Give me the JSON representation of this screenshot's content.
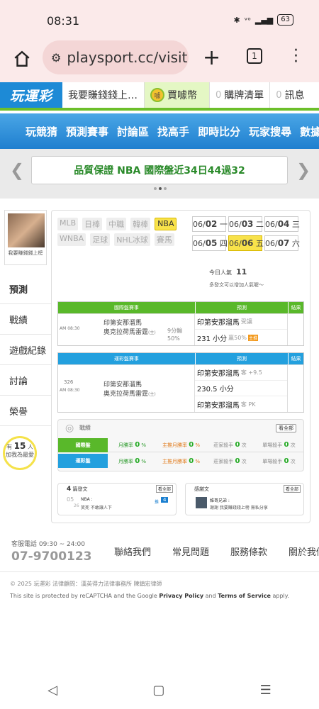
{
  "status": {
    "time": "08:31",
    "battery": "63"
  },
  "browser": {
    "url": "playsport.cc/visit",
    "tab_count": "1"
  },
  "topnav": {
    "logo": "玩運彩",
    "earn": "我要賺錢錢上…",
    "buy": "買噱幣",
    "coin_text": "噱",
    "cart_count": "0",
    "cart": "購牌清單",
    "msg_count": "0",
    "msg": "訊息"
  },
  "bluenav": [
    "玩競猜",
    "預測賽事",
    "討論區",
    "找高手",
    "即時比分",
    "玩家搜尋",
    "數據"
  ],
  "banner": {
    "text": "品質保證 NBA 國際盤近34日44過32"
  },
  "profile": {
    "name": "我要賺錢錢上榜"
  },
  "sidebar": [
    "預測",
    "戰績",
    "遊戲紀錄",
    "討論",
    "榮譽"
  ],
  "likes": {
    "pre": "有",
    "count": "15",
    "post": "人",
    "line2": "加我為最愛"
  },
  "sports": [
    {
      "label": "MLB",
      "active": false
    },
    {
      "label": "日棒",
      "active": false
    },
    {
      "label": "中職",
      "active": false
    },
    {
      "label": "韓棒",
      "active": false
    },
    {
      "label": "NBA",
      "active": true
    },
    {
      "label": "WNBA",
      "active": false
    },
    {
      "label": "足球",
      "active": false
    },
    {
      "label": "NHL冰球",
      "active": false
    },
    {
      "label": "賽馬",
      "active": false
    }
  ],
  "dates": [
    {
      "m": "06/",
      "d": "02",
      "w": "一",
      "active": false
    },
    {
      "m": "06/",
      "d": "03",
      "w": "二",
      "active": false
    },
    {
      "m": "06/",
      "d": "04",
      "w": "三",
      "active": false
    },
    {
      "m": "06/",
      "d": "05",
      "w": "四",
      "active": false
    },
    {
      "m": "06/",
      "d": "06",
      "w": "五",
      "active": true
    },
    {
      "m": "06/",
      "d": "07",
      "w": "六",
      "active": false
    }
  ],
  "popularity": {
    "label": "今日人氣",
    "value": "11",
    "hint": "多發文可以增加人氣喔～"
  },
  "intl_table": {
    "headers": [
      "國際盤賽事",
      "預測",
      "結果"
    ],
    "time": "AM 08:30",
    "team1": "印第安那溜馬",
    "team2": "奧克拉荷馬雷霆",
    "team2_suffix": "(主)",
    "margin": "9分輸",
    "pct": "50%",
    "pick1": "印第安那溜馬",
    "pick1_note": "受讓",
    "pick2": "231 小分",
    "pick2_note": "贏50%",
    "tag": "主推"
  },
  "lottery_table": {
    "headers": [
      "運彩盤賽事",
      "預測",
      "結果"
    ],
    "code": "326",
    "time": "AM 08:30",
    "team1": "印第安那溜馬",
    "team2": "奧克拉荷馬雷霆",
    "team2_suffix": "(主)",
    "pick1": "印第安那溜馬",
    "pick1_note": "客 +9.5",
    "pick2": "230.5 小分",
    "pick3": "印第安那溜馬",
    "pick3_note": "客 PK"
  },
  "record": {
    "title": "戰績",
    "all": "看全部",
    "rows": [
      {
        "label": "國際盤",
        "c1": "月勝率",
        "v1": "0",
        "u1": "%",
        "c2": "主推月勝率",
        "v2": "0",
        "u2": "%",
        "c3": "莊家殺手",
        "v3": "0",
        "u3": "次",
        "c4": "單場殺手",
        "v4": "0",
        "u4": "次",
        "color": "#59b82a"
      },
      {
        "label": "運彩盤",
        "c1": "月勝率",
        "v1": "0",
        "u1": "%",
        "c2": "主推月勝率",
        "v2": "0",
        "u2": "%",
        "c3": "莊家殺手",
        "v3": "0",
        "u3": "次",
        "c4": "單場殺手",
        "v4": "0",
        "u4": "次",
        "color": "#23a0de"
      }
    ]
  },
  "posts": {
    "count": "4",
    "label": "篇發文",
    "all": "看全部",
    "date_m": "05",
    "date_d": "26",
    "title": "NBA :",
    "sub": "笑死 不敢讓人下",
    "badge_label": "推",
    "badge": "4"
  },
  "thanks": {
    "label": "感謝文",
    "all": "看全部",
    "title": "維哥兄弟 :",
    "sub": "謝謝 我要賺錢錢上榜 無私分享"
  },
  "footer": {
    "tel_label": "客服電話 09:30 ~ 24:00",
    "tel": "07-9700123",
    "links": [
      "聯絡我們",
      "常見問題",
      "服務條款",
      "關於我們"
    ],
    "copyright": "© 2025 玩運彩 法律顧問：漢英得力法律事務所 陳鎮宏律師",
    "recaptcha_pre": "This site is protected by reCAPTCHA and the Google",
    "privacy": "Privacy Policy",
    "and": "and",
    "terms": "Terms of Service",
    "apply": "apply."
  }
}
